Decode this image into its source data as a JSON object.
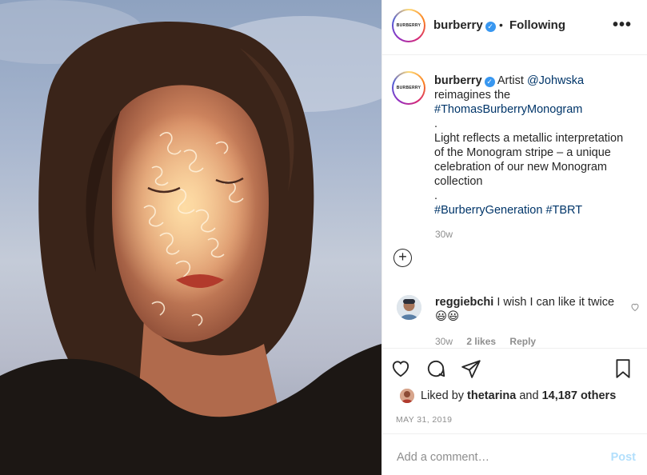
{
  "post_image": {
    "alt": ""
  },
  "header": {
    "avatar_text": "BURBERRY",
    "username": "burberry",
    "separator": "•",
    "follow_status": "Following",
    "more": "•••"
  },
  "caption": {
    "avatar_text": "BURBERRY",
    "username": "burberry",
    "text_1": "Artist",
    "mention": "@Johwska",
    "text_2": "reimagines the",
    "hashtag_1": "#ThomasBurberryMonogram",
    "dot_1": ".",
    "body": "Light reflects a metallic interpretation of the Monogram stripe – a unique celebration of our new Monogram collection",
    "dot_2": ".",
    "hashtag_2": "#BurberryGeneration",
    "hashtag_3": "#TBRT",
    "time": "30w",
    "plus": "+"
  },
  "comment": {
    "username": "reggiebchi",
    "text": "I wish I can like it twice",
    "emoji": "😃😃",
    "time": "30w",
    "likes": "2 likes",
    "reply": "Reply"
  },
  "likes": {
    "prefix": "Liked by",
    "user": "thetarina",
    "and": "and",
    "count": "14,187 others"
  },
  "date": "MAY 31, 2019",
  "add_comment": {
    "placeholder": "Add a comment…",
    "post_label": "Post"
  },
  "colors": {
    "link": "#003569",
    "verified": "#3897f0",
    "post_disabled": "#b2dffc",
    "muted": "#8e8e8e"
  }
}
